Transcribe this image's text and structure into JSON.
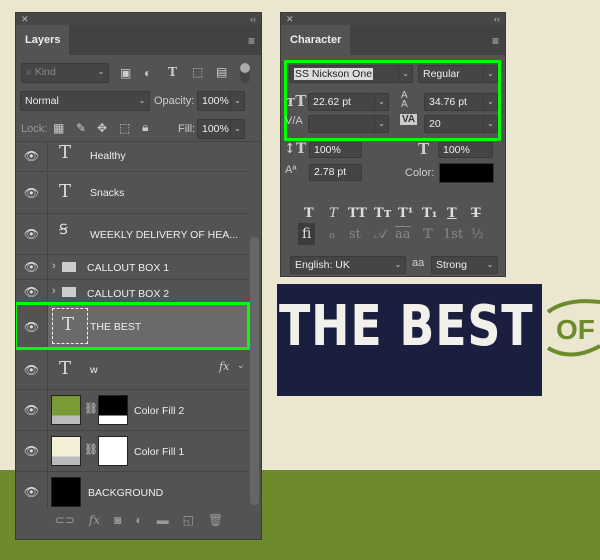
{
  "canvas": {
    "background": "#ebe6cf",
    "ground_color": "#6d8b2b",
    "banner_color": "#1b1f3f",
    "banner_text": "THE BEST",
    "ribbon_text": "OF"
  },
  "layers_panel": {
    "close": "✕",
    "collapse": "‹‹",
    "tab": "Layers",
    "menu_icon": "hamburger-icon",
    "filter": {
      "placeholder": "Kind"
    },
    "blend_mode": "Normal",
    "opacity_label": "Opacity:",
    "opacity": "100%",
    "lock_label": "Lock:",
    "fill_label": "Fill:",
    "fill": "100%",
    "layers": [
      {
        "name": "Healthy",
        "type": "text"
      },
      {
        "name": "Snacks",
        "type": "text"
      },
      {
        "name": "WEEKLY DELIVERY OF HEA...",
        "type": "warped-text"
      },
      {
        "name": "CALLOUT BOX 1",
        "type": "group"
      },
      {
        "name": "CALLOUT BOX 2",
        "type": "group"
      },
      {
        "name": "THE BEST",
        "type": "text",
        "selected": true
      },
      {
        "name": "w",
        "type": "text",
        "fx": "fx"
      },
      {
        "name": "Color Fill 2",
        "type": "fill",
        "color": "#7a9a35"
      },
      {
        "name": "Color Fill 1",
        "type": "fill",
        "color": "#f4f0d8"
      },
      {
        "name": "BACKGROUND",
        "type": "background",
        "color": "#000000"
      }
    ],
    "highlight_color": "#00ff00"
  },
  "character_panel": {
    "close": "✕",
    "collapse": "‹‹",
    "tab": "Character",
    "font_family": "SS Nickson One",
    "font_style": "Regular",
    "font_size": "22.62 pt",
    "leading": "34.76 pt",
    "kerning": "",
    "tracking": "20",
    "vertical_scale": "100%",
    "horizontal_scale": "100%",
    "baseline_shift": "2.78 pt",
    "color_label": "Color:",
    "color": "#000000",
    "type_buttons": [
      "T",
      "T",
      "TT",
      "Tт",
      "T¹",
      "T₁",
      "T",
      "T"
    ],
    "opentype_buttons": [
      "fi",
      "ℴ",
      "st",
      "𝒜",
      "aa",
      "𝕋",
      "1st",
      "½"
    ],
    "language": "English: UK",
    "aa_label": "aa",
    "antialias": "Strong"
  }
}
